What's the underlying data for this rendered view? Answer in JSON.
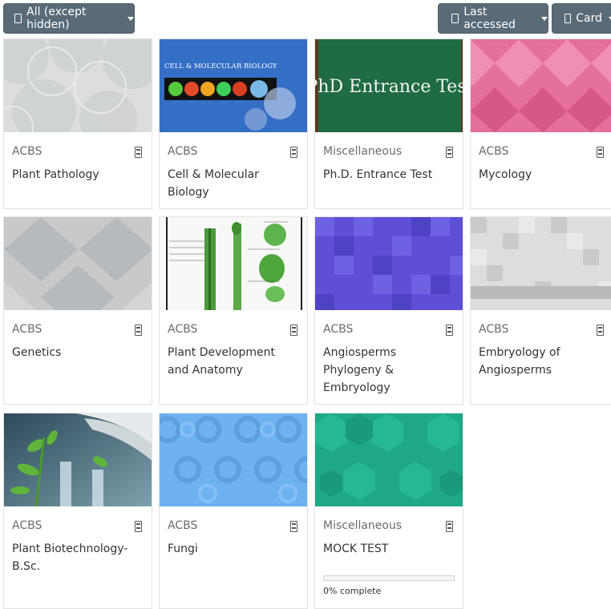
{
  "toolbar": {
    "filter_label": "All (except hidden)",
    "sort_label": "Last accessed",
    "view_label": "Card"
  },
  "courses": [
    {
      "category": "ACBS",
      "title": "Plant Pathology",
      "thumb": "gray-circles-pattern"
    },
    {
      "category": "ACBS",
      "title": "Cell & Molecular Biology",
      "thumb": "cell-molecular-biology-banner",
      "banner_text": "CELL & MOLECULAR BIOLOGY"
    },
    {
      "category": "Miscellaneous",
      "title": "Ph.D. Entrance Test",
      "thumb": "chalkboard",
      "banner_text": "PhD Entrance Test"
    },
    {
      "category": "ACBS",
      "title": "Mycology",
      "thumb": "pink-diamond-pattern"
    },
    {
      "category": "ACBS",
      "title": "Genetics",
      "thumb": "gray-diamond-pattern"
    },
    {
      "category": "ACBS",
      "title": "Plant Development and Anatomy",
      "thumb": "plant-anatomy-diagram"
    },
    {
      "category": "ACBS",
      "title": "Angiosperms Phylogeny & Embryology",
      "thumb": "purple-squares-pattern"
    },
    {
      "category": "ACBS",
      "title": "Embryology of Angiosperms",
      "thumb": "gray-squares-pattern"
    },
    {
      "category": "ACBS",
      "title": "Plant Biotechnology-B.Sc.",
      "thumb": "plant-test-tube-photo"
    },
    {
      "category": "ACBS",
      "title": "Fungi",
      "thumb": "blue-rings-pattern"
    },
    {
      "category": "Miscellaneous",
      "title": "MOCK TEST",
      "thumb": "green-hexagon-pattern",
      "progress_percent": 0,
      "progress_text": "0% complete"
    }
  ],
  "colors": {
    "button_bg": "#5a6a77",
    "progress_fill": "#0f6fc5"
  }
}
